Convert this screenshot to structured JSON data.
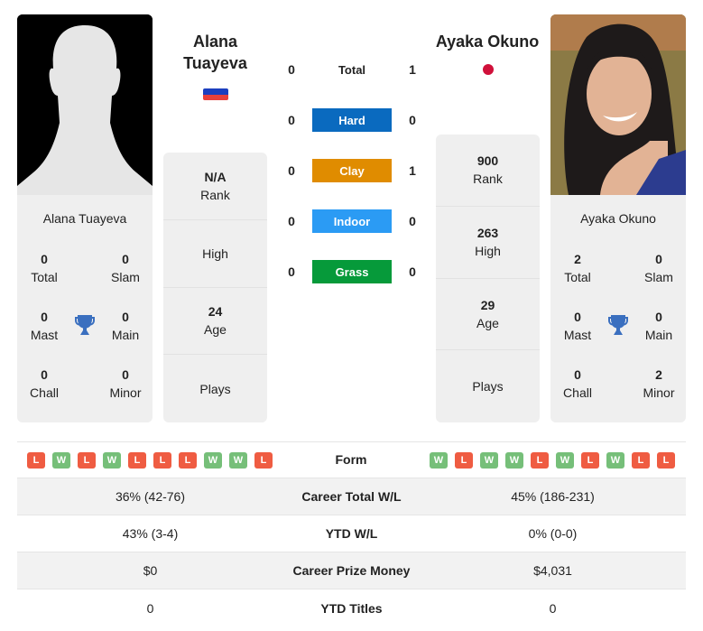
{
  "player1": {
    "name": "Alana Tuayeva",
    "name_line1": "Alana",
    "name_line2": "Tuayeva",
    "country": "Russia",
    "flag_colors": [
      "#ffffff",
      "#1c3fbf",
      "#e8403b"
    ],
    "titles": [
      {
        "value": "0",
        "label": "Total"
      },
      {
        "value": "0",
        "label": "Slam"
      },
      {
        "value": "0",
        "label": "Mast"
      },
      {
        "value": "0",
        "label": "Main"
      },
      {
        "value": "0",
        "label": "Chall"
      },
      {
        "value": "0",
        "label": "Minor"
      }
    ],
    "stats": [
      {
        "value": "N/A",
        "label": "Rank"
      },
      {
        "value": "",
        "label": "High"
      },
      {
        "value": "24",
        "label": "Age"
      },
      {
        "value": "",
        "label": "Plays"
      }
    ],
    "form": [
      "L",
      "W",
      "L",
      "W",
      "L",
      "L",
      "L",
      "W",
      "W",
      "L"
    ]
  },
  "player2": {
    "name": "Ayaka Okuno",
    "country": "Japan",
    "flag_color": "#d0103a",
    "titles": [
      {
        "value": "2",
        "label": "Total"
      },
      {
        "value": "0",
        "label": "Slam"
      },
      {
        "value": "0",
        "label": "Mast"
      },
      {
        "value": "0",
        "label": "Main"
      },
      {
        "value": "0",
        "label": "Chall"
      },
      {
        "value": "2",
        "label": "Minor"
      }
    ],
    "stats": [
      {
        "value": "900",
        "label": "Rank"
      },
      {
        "value": "263",
        "label": "High"
      },
      {
        "value": "29",
        "label": "Age"
      },
      {
        "value": "",
        "label": "Plays"
      }
    ],
    "form": [
      "W",
      "L",
      "W",
      "W",
      "L",
      "W",
      "L",
      "W",
      "L",
      "L"
    ]
  },
  "h2h": [
    {
      "label": "Total",
      "p1": "0",
      "p2": "1",
      "color": ""
    },
    {
      "label": "Hard",
      "p1": "0",
      "p2": "0",
      "color": "#0a6abf"
    },
    {
      "label": "Clay",
      "p1": "0",
      "p2": "1",
      "color": "#e08c00"
    },
    {
      "label": "Indoor",
      "p1": "0",
      "p2": "0",
      "color": "#2b9bf4"
    },
    {
      "label": "Grass",
      "p1": "0",
      "p2": "0",
      "color": "#069a3a"
    }
  ],
  "form_label": "Form",
  "comparison": [
    {
      "label": "Career Total W/L",
      "p1": "36% (42-76)",
      "p2": "45% (186-231)"
    },
    {
      "label": "YTD W/L",
      "p1": "43% (3-4)",
      "p2": "0% (0-0)"
    },
    {
      "label": "Career Prize Money",
      "p1": "$0",
      "p2": "$4,031"
    },
    {
      "label": "YTD Titles",
      "p1": "0",
      "p2": "0"
    }
  ],
  "trophy_color": "#3a6fbf"
}
